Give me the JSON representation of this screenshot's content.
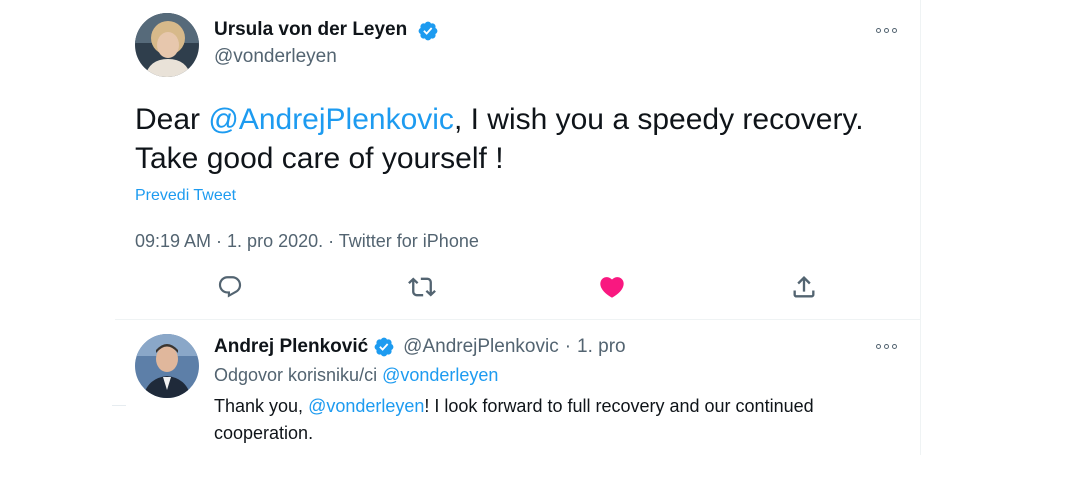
{
  "tweet": {
    "author_name": "Ursula von der Leyen",
    "author_handle": "@vonderleyen",
    "text_part1": "Dear ",
    "text_mention": "@AndrejPlenkovic",
    "text_part2": ", I wish you a speedy recovery. Take good care of yourself !",
    "translate_label": "Prevedi Tweet",
    "meta": "09:19 AM · 1. pro 2020. · Twitter for iPhone",
    "liked": true
  },
  "reply": {
    "author_name": "Andrej Plenković",
    "author_handle": "@AndrejPlenkovic",
    "separator": "·",
    "date": "1. pro",
    "replying_prefix": "Odgovor korisniku/ci ",
    "replying_mention": "@vonderleyen",
    "text_part1": "Thank you, ",
    "text_mention": "@vonderleyen",
    "text_part2": "! I look forward to full recovery and our continued cooperation."
  },
  "icons": {
    "verified": "verified-badge-icon",
    "more": "more-options-icon",
    "reply": "reply-icon",
    "retweet": "retweet-icon",
    "like": "heart-icon",
    "share": "share-icon"
  },
  "colors": {
    "accent": "#1d9bf0",
    "like": "#f91880",
    "secondary_text": "#536471"
  }
}
